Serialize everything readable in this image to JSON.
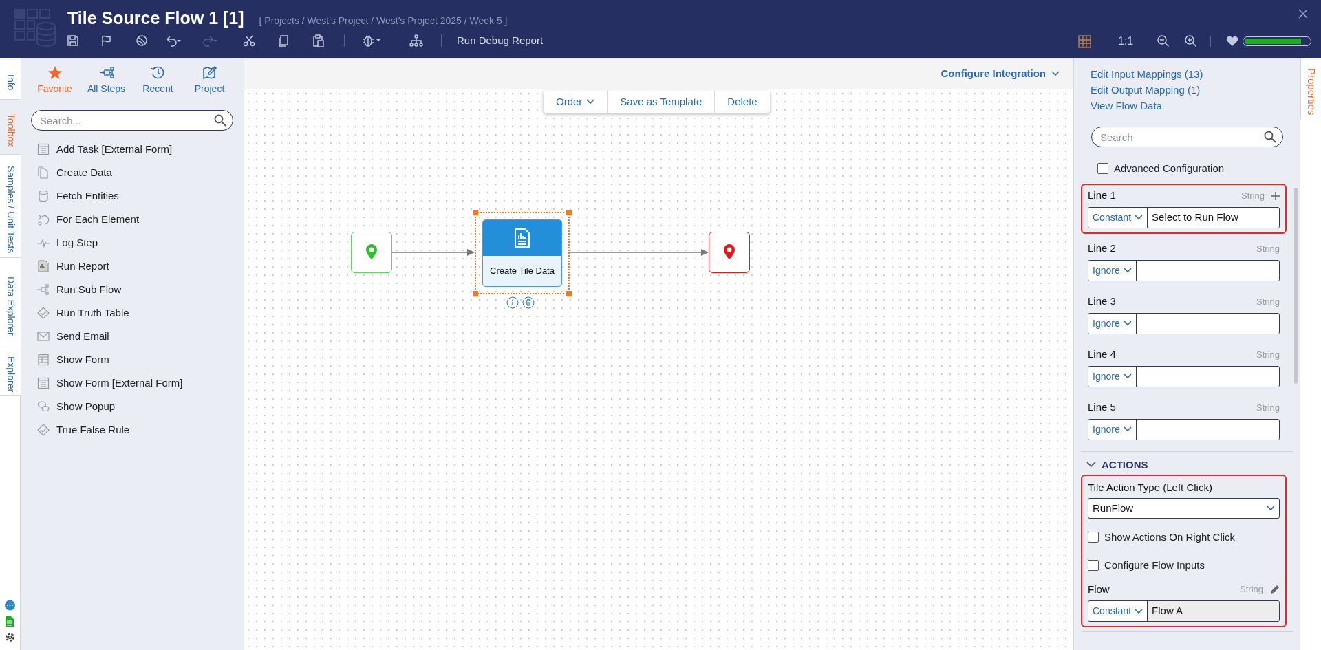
{
  "window": {
    "title": "Tile Source Flow 1 [1]",
    "breadcrumb": "[ Projects / West's Project / West's Project 2025 / Week 5 ]"
  },
  "toolbar": {
    "run_debug_report": "Run Debug Report",
    "zoom_reset": "1:1",
    "health_meter": {
      "level": 0.87
    }
  },
  "left_tabs": [
    {
      "label": "Info",
      "selected": false
    },
    {
      "label": "Toolbox",
      "selected": true
    },
    {
      "label": "Samples / Unit Tests",
      "selected": false
    },
    {
      "label": "Data Explorer",
      "selected": false
    },
    {
      "label": "Explorer",
      "selected": false
    }
  ],
  "toolbox": {
    "tabs": [
      {
        "label": "Favorite",
        "selected": true
      },
      {
        "label": "All Steps",
        "selected": false
      },
      {
        "label": "Recent",
        "selected": false
      },
      {
        "label": "Project",
        "selected": false
      }
    ],
    "search": {
      "placeholder": "Search..."
    },
    "items": [
      "Add Task [External Form]",
      "Create Data",
      "Fetch Entities",
      "For Each Element",
      "Log Step",
      "Run Report",
      "Run Sub Flow",
      "Run Truth Table",
      "Send Email",
      "Show Form",
      "Show Form [External Form]",
      "Show Popup",
      "True False Rule"
    ]
  },
  "canvas": {
    "header": "Configure Integration",
    "context_menu": [
      {
        "label": "Order",
        "kind": "dropdown"
      },
      {
        "label": "Save as Template",
        "kind": "button"
      },
      {
        "label": "Delete",
        "kind": "button"
      }
    ],
    "nodes": [
      {
        "kind": "start"
      },
      {
        "kind": "step",
        "label": "Create Tile Data",
        "selected": true
      },
      {
        "kind": "end"
      }
    ]
  },
  "properties": {
    "links": [
      "Edit Input Mappings (13)",
      "Edit Output Mapping (1)",
      "View Flow Data"
    ],
    "search": {
      "placeholder": "Search"
    },
    "advanced_configuration": {
      "label": "Advanced Configuration",
      "checked": false
    },
    "inputs": [
      {
        "label": "Line 1",
        "type": "String",
        "mode": "Constant",
        "value": "Select to Run Flow",
        "highlighted": true
      },
      {
        "label": "Line 2",
        "type": "String",
        "mode": "Ignore",
        "highlighted": false
      },
      {
        "label": "Line 3",
        "type": "String",
        "mode": "Ignore",
        "highlighted": false
      },
      {
        "label": "Line 4",
        "type": "String",
        "mode": "Ignore",
        "highlighted": false
      },
      {
        "label": "Line 5",
        "type": "String",
        "mode": "Ignore",
        "highlighted": false
      }
    ],
    "actions": {
      "title": "ACTIONS",
      "expanded": true,
      "highlighted": true,
      "action_type": {
        "label": "Tile Action Type (Left Click)",
        "value": "RunFlow"
      },
      "checkboxes": [
        {
          "label": "Show Actions On Right Click",
          "checked": false
        },
        {
          "label": "Configure Flow Inputs",
          "checked": false
        }
      ],
      "flow": {
        "label": "Flow",
        "type": "String",
        "mode": "Constant",
        "value": "Flow A"
      }
    }
  },
  "right_tabs": [
    {
      "label": "Properties",
      "selected": true
    }
  ]
}
